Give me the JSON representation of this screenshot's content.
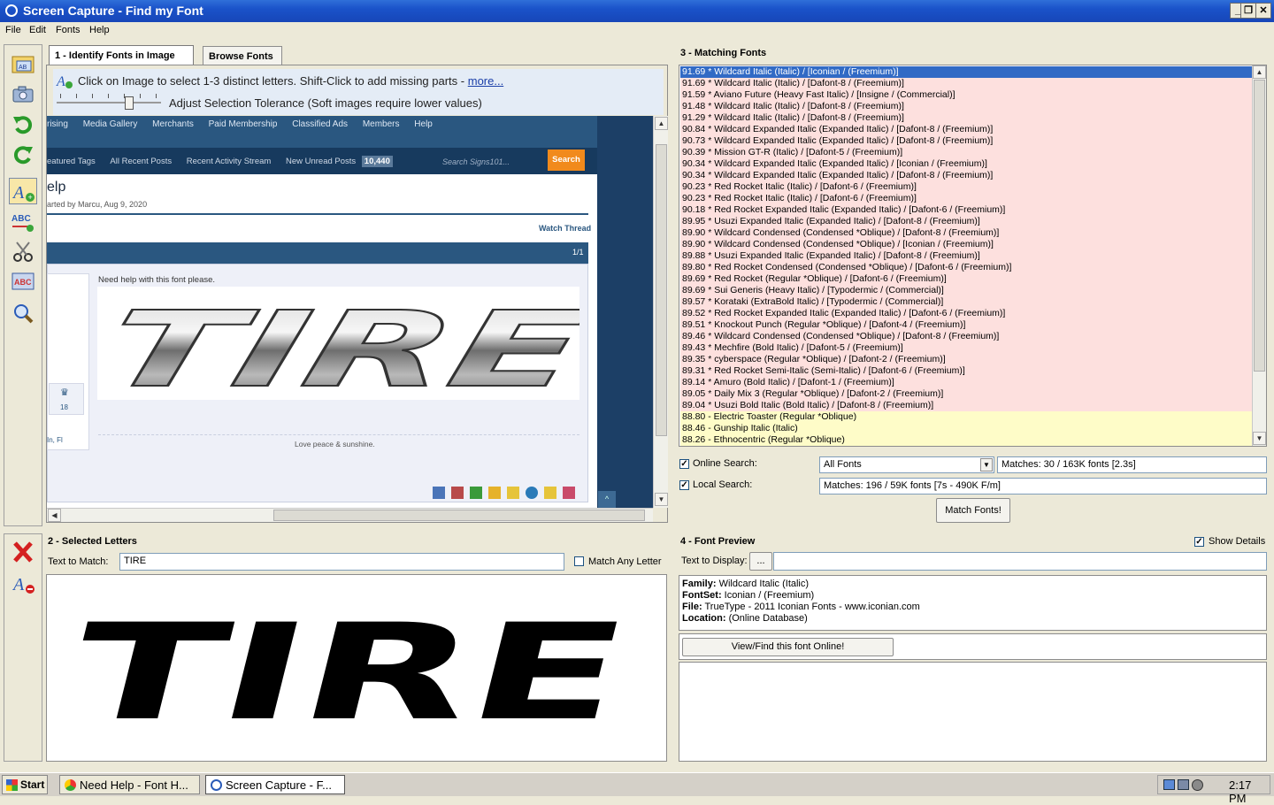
{
  "window": {
    "title": "Screen Capture - Find my Font",
    "minimize": "_",
    "restore": "❐",
    "close": "✕"
  },
  "menu": [
    "File",
    "Edit",
    "Fonts",
    "Help"
  ],
  "tabs": [
    "1 - Identify Fonts in Image",
    "Browse Fonts"
  ],
  "panel1": {
    "hint": "Click on Image to select 1-3 distinct letters. Shift-Click to add missing parts -",
    "more_link": "more...",
    "tolerance_label": "Adjust Selection Tolerance (Soft images require lower values)",
    "tolerance_level": 0.6
  },
  "captured_page": {
    "nav": [
      "rising",
      "Media Gallery",
      "Merchants",
      "Paid Membership",
      "Classified Ads",
      "Members",
      "Help"
    ],
    "subnav": [
      "eatured Tags",
      "All Recent Posts",
      "Recent Activity Stream",
      "New Unread Posts"
    ],
    "unread_count": "10,440",
    "search_placeholder": "Search Signs101...",
    "search_button": "Search",
    "thread_title": "elp",
    "thread_meta": "arted by Marcu, Aug 9, 2020",
    "watch": "Watch Thread",
    "page": "1/1",
    "post_text": "Need help with this font please.",
    "sample_word": "TIRE",
    "likes": "18",
    "location": "In, Fl",
    "signature": "Love peace & sunshine."
  },
  "panel2": {
    "title": "2 - Selected Letters",
    "text_to_match_label": "Text to Match:",
    "text_to_match_value": "TIRE",
    "match_any_letter": "Match Any Letter",
    "preview_text": "TIRE"
  },
  "panel3": {
    "title": "3 - Matching Fonts",
    "matches": [
      "91.69 * Wildcard Italic (Italic) / [Iconian / (Freemium)]",
      "91.69 * Wildcard Italic (Italic) / [Dafont-8 / (Freemium)]",
      "91.59 * Aviano Future (Heavy Fast Italic) / [Insigne / (Commercial)]",
      "91.48 * Wildcard Italic (Italic) / [Dafont-8 / (Freemium)]",
      "91.29 * Wildcard Italic (Italic) / [Dafont-8 / (Freemium)]",
      "90.84 * Wildcard Expanded Italic (Expanded Italic) / [Dafont-8 / (Freemium)]",
      "90.73 * Wildcard Expanded Italic (Expanded Italic) / [Dafont-8 / (Freemium)]",
      "90.39 * Mission GT-R (Italic) / [Dafont-5 / (Freemium)]",
      "90.34 * Wildcard Expanded Italic (Expanded Italic) / [Iconian / (Freemium)]",
      "90.34 * Wildcard Expanded Italic (Expanded Italic) / [Dafont-8 / (Freemium)]",
      "90.23 * Red Rocket Italic (Italic) / [Dafont-6 / (Freemium)]",
      "90.23 * Red Rocket Italic (Italic) / [Dafont-6 / (Freemium)]",
      "90.18 * Red Rocket Expanded Italic (Expanded Italic) / [Dafont-6 / (Freemium)]",
      "89.95 * Usuzi Expanded Italic (Expanded Italic) / [Dafont-8 / (Freemium)]",
      "89.90 * Wildcard  Condensed (Condensed *Oblique) / [Dafont-8 / (Freemium)]",
      "89.90 * Wildcard  Condensed (Condensed *Oblique) / [Iconian / (Freemium)]",
      "89.88 * Usuzi Expanded Italic (Expanded Italic) / [Dafont-8 / (Freemium)]",
      "89.80 * Red Rocket Condensed (Condensed *Oblique) / [Dafont-6 / (Freemium)]",
      "89.69 * Red Rocket (Regular *Oblique) / [Dafont-6 / (Freemium)]",
      "89.69 * Sui Generis (Heavy Italic) / [Typodermic / (Commercial)]",
      "89.57 * Korataki (ExtraBold Italic) / [Typodermic / (Commercial)]",
      "89.52 * Red Rocket Expanded Italic (Expanded Italic) / [Dafont-6 / (Freemium)]",
      "89.51 * Knockout Punch (Regular *Oblique) / [Dafont-4 / (Freemium)]",
      "89.46 * Wildcard Condensed (Condensed *Oblique) / [Dafont-8 / (Freemium)]",
      "89.43 * Mechfire (Bold Italic) / [Dafont-5 / (Freemium)]",
      "89.35 * cyberspace (Regular *Oblique) / [Dafont-2 / (Freemium)]",
      "89.31 * Red Rocket Semi-Italic (Semi-Italic) / [Dafont-6 / (Freemium)]",
      "89.14 * Amuro (Bold Italic) / [Dafont-1 / (Freemium)]",
      "89.05 * Daily Mix 3 (Regular *Oblique) / [Dafont-2 / (Freemium)]",
      "89.04 * Usuzi Bold Italic (Bold Italic) / [Dafont-8 / (Freemium)]",
      "88.80 - Electric Toaster (Regular *Oblique)",
      "88.46 - Gunship Italic (Italic)",
      "88.26 - Ethnocentric (Regular *Oblique)"
    ],
    "online_search_label": "Online Search:",
    "online_search_option": "All Fonts",
    "online_matches": "Matches: 30 / 163K fonts [2.3s]",
    "local_search_label": "Local Search:",
    "local_matches": "Matches: 196 / 59K fonts [7s - 490K F/m]",
    "match_button": "Match Fonts!"
  },
  "panel4": {
    "title": "4 - Font Preview",
    "show_details": "Show Details",
    "text_to_display_label": "Text to Display:",
    "ellipsis_button": "...",
    "family_label": "Family:",
    "family_value": "Wildcard Italic (Italic)",
    "fontset_label": "FontSet:",
    "fontset_value": "Iconian / (Freemium)",
    "file_label": "File:",
    "file_value": "TrueType  - 2011 Iconian Fonts - www.iconian.com",
    "location_label": "Location:",
    "location_value": "(Online Database)",
    "view_online_button": "View/Find this font Online!"
  },
  "taskbar": {
    "start": "Start",
    "tasks": [
      "Need Help - Font H...",
      "Screen Capture - F..."
    ],
    "clock": "2:17 PM"
  },
  "colors": {
    "selected_row": "#316ac5",
    "red_row": "#fde0de",
    "yellow_row": "#fefcc8",
    "titlebar": "#1a52c9"
  }
}
